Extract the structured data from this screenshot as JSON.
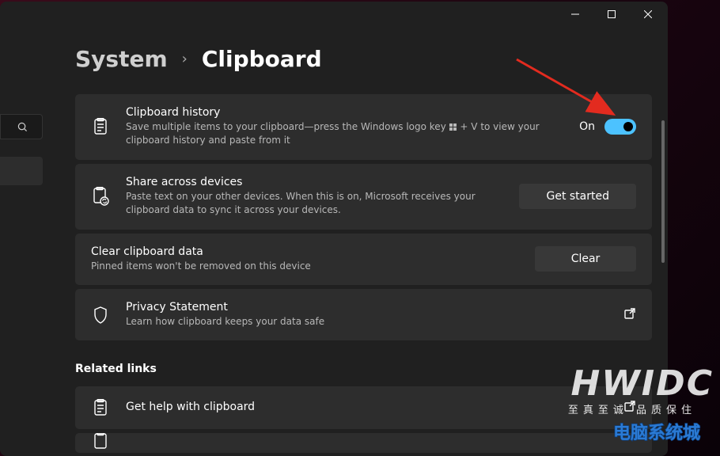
{
  "breadcrumb": {
    "parent": "System",
    "current": "Clipboard"
  },
  "cards": {
    "history": {
      "title": "Clipboard history",
      "desc_pre": "Save multiple items to your clipboard—press the Windows logo key ",
      "desc_post": " + V to view your clipboard history and paste from it",
      "toggle_label": "On"
    },
    "share": {
      "title": "Share across devices",
      "desc": "Paste text on your other devices. When this is on, Microsoft receives your clipboard data to sync it across your devices.",
      "btn": "Get started"
    },
    "clear": {
      "title": "Clear clipboard data",
      "desc": "Pinned items won't be removed on this device",
      "btn": "Clear"
    },
    "privacy": {
      "title": "Privacy Statement",
      "desc": "Learn how clipboard keeps your data safe"
    },
    "help": {
      "title": "Get help with clipboard"
    }
  },
  "section": {
    "related": "Related links"
  },
  "watermark": {
    "brand": "HWIDC",
    "tagline": "至真至诚  品质保住",
    "logo": "电脑系统城"
  },
  "colors": {
    "accent": "#4cc2ff",
    "arrow": "#e32b1f"
  }
}
